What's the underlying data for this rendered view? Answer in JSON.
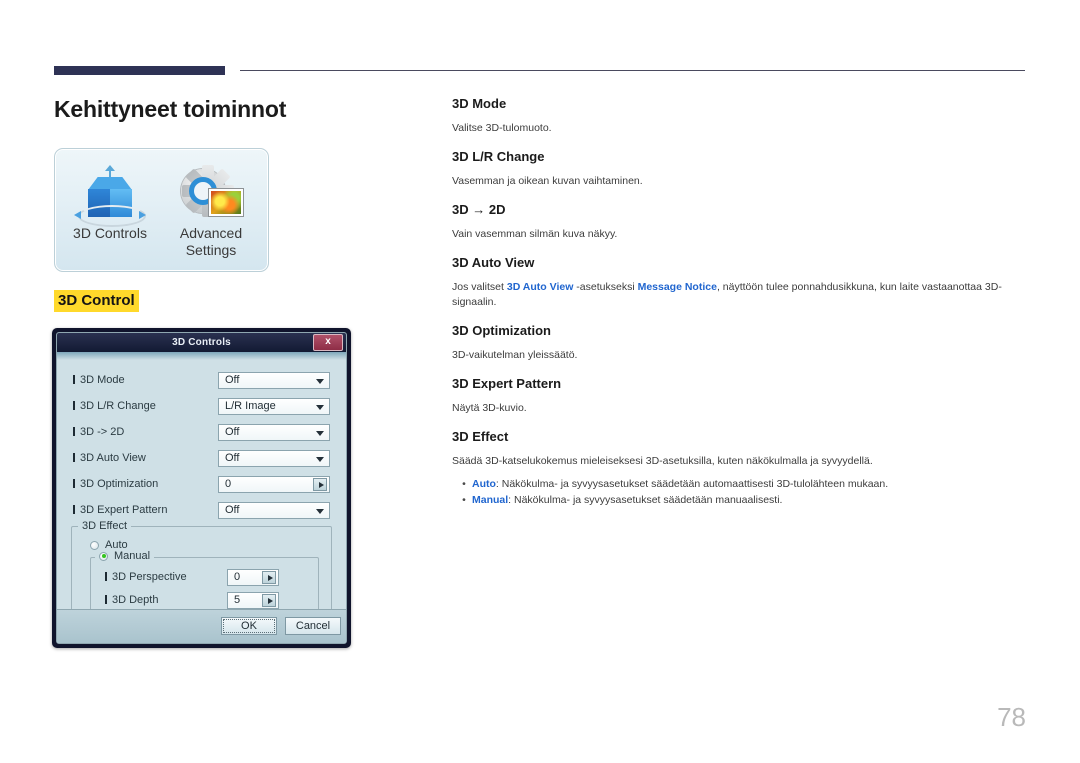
{
  "page": {
    "title": "Kehittyneet toiminnot",
    "number": "78",
    "section_highlight": "3D Control"
  },
  "menu_panel": {
    "tiles": [
      {
        "label_line1": "3D Controls",
        "label_line2": "",
        "icon": "3d-cube-icon"
      },
      {
        "label_line1": "Advanced",
        "label_line2": "Settings",
        "icon": "gear-picture-icon"
      }
    ]
  },
  "dialog": {
    "title": "3D Controls",
    "close_label": "x",
    "rows": [
      {
        "label": "3D Mode",
        "value": "Off",
        "control": "dropdown"
      },
      {
        "label": "3D L/R Change",
        "value": "L/R Image",
        "control": "dropdown"
      },
      {
        "label": "3D -> 2D",
        "value": "Off",
        "control": "dropdown"
      },
      {
        "label": "3D Auto View",
        "value": "Off",
        "control": "dropdown"
      },
      {
        "label": "3D Optimization",
        "value": "0",
        "control": "stepper"
      },
      {
        "label": "3D Expert Pattern",
        "value": "Off",
        "control": "dropdown"
      }
    ],
    "effect_group": {
      "caption": "3D Effect",
      "auto_label": "Auto",
      "auto_selected": false,
      "manual_label": "Manual",
      "manual_selected": true,
      "manual_rows": [
        {
          "label": "3D Perspective",
          "value": "0"
        },
        {
          "label": "3D Depth",
          "value": "5"
        }
      ]
    },
    "ok_label": "OK",
    "cancel_label": "Cancel"
  },
  "entries": [
    {
      "title": "3D Mode",
      "body": "Valitse 3D-tulomuoto."
    },
    {
      "title": "3D L/R Change",
      "body": "Vasemman ja oikean kuvan vaihtaminen."
    },
    {
      "title": "3D → 2D",
      "body": "Vain vasemman silmän kuva näkyy."
    },
    {
      "title": "3D Auto View",
      "body_pre": "Jos valitset ",
      "kw1": "3D Auto View",
      "body_mid": " -asetukseksi ",
      "kw2": "Message Notice",
      "body_post": ", näyttöön tulee ponnahdusikkuna, kun laite vastaanottaa 3D-signaalin."
    },
    {
      "title": "3D Optimization",
      "body": "3D-vaikutelman yleissäätö."
    },
    {
      "title": "3D Expert Pattern",
      "body": "Näytä 3D-kuvio."
    },
    {
      "title": "3D Effect",
      "body": "Säädä 3D-katselukokemus mieleiseksesi 3D-asetuksilla, kuten näkökulmalla ja syvyydellä.",
      "bullets": [
        {
          "dot": "•",
          "kw": "Auto",
          "text": ": Näkökulma- ja syvyysasetukset säädetään automaattisesti 3D-tulolähteen mukaan."
        },
        {
          "dot": "•",
          "kw": "Manual",
          "text": ": Näkökulma- ja syvyysasetukset säädetään manuaalisesti."
        }
      ]
    }
  ],
  "colors": {
    "rule": "#2e3255",
    "highlight": "#ffd92b",
    "keyword": "#2166cf",
    "dialog_frame": "#10142c",
    "dialog_body": "#cfe0e6"
  }
}
